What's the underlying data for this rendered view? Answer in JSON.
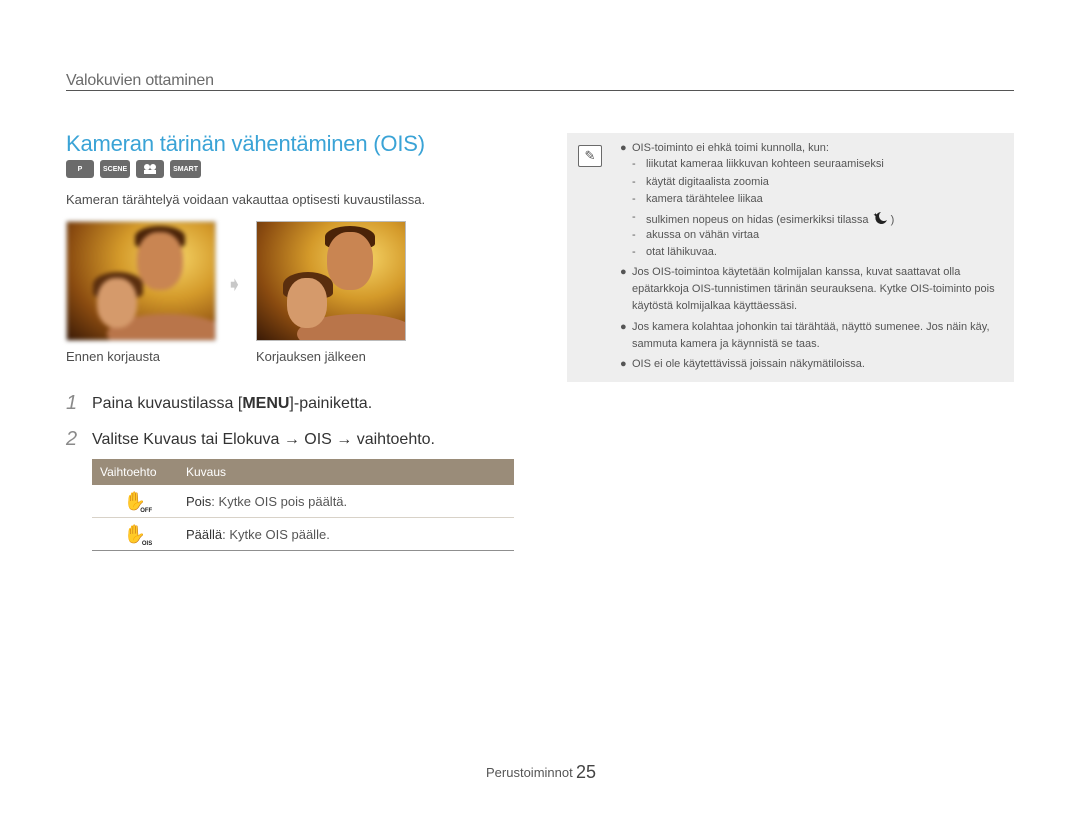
{
  "header": {
    "section": "Valokuvien ottaminen"
  },
  "title": "Kameran tärinän vähentäminen (OIS)",
  "mode_icons": [
    {
      "name": "program-mode-icon",
      "label": "P"
    },
    {
      "name": "scene-mode-icon",
      "label": "SCENE"
    },
    {
      "name": "movie-mode-icon",
      "label": ""
    },
    {
      "name": "smart-movie-mode-icon",
      "label": "SMART"
    }
  ],
  "intro": "Kameran tärähtelyä voidaan vakauttaa optisesti kuvaustilassa.",
  "images": {
    "before_caption": "Ennen korjausta",
    "after_caption": "Korjauksen jälkeen"
  },
  "steps": [
    {
      "num": "1",
      "pre": "Paina kuvaustilassa [",
      "key": "MENU",
      "post": "]-painiketta."
    },
    {
      "num": "2",
      "pre": "Valitse ",
      "a": "Kuvaus",
      "mid": " tai ",
      "b": "Elokuva",
      "arrow1": " → ",
      "c": "OIS",
      "arrow2": " → ",
      "post": "vaihtoehto."
    }
  ],
  "table": {
    "headers": [
      "Vaihtoehto",
      "Kuvaus"
    ],
    "rows": [
      {
        "icon": "ois-off-icon",
        "icon_badge": "OFF",
        "term": "Pois",
        "desc": ": Kytke OIS pois päältä."
      },
      {
        "icon": "ois-on-icon",
        "icon_badge": "OIS",
        "term": "Päällä",
        "desc": ": Kytke OIS päälle."
      }
    ]
  },
  "note": {
    "bullet1": "OIS-toiminto ei ehkä toimi kunnolla, kun:",
    "subitems": [
      "liikutat kameraa liikkuvan kohteen seuraamiseksi",
      "käytät digitaalista zoomia",
      "kamera tärähtelee liikaa",
      "sulkimen nopeus on hidas (esimerkiksi tilassa",
      "akussa on vähän virtaa",
      "otat lähikuvaa."
    ],
    "night_close": ")",
    "bullet2": "Jos OIS-toimintoa käytetään kolmijalan kanssa, kuvat saattavat olla epätarkkoja OIS-tunnistimen tärinän seurauksena. Kytke OIS-toiminto pois käytöstä kolmijalkaa käyttäessäsi.",
    "bullet3": "Jos kamera kolahtaa johonkin tai tärähtää, näyttö sumenee. Jos näin käy, sammuta kamera ja käynnistä se taas.",
    "bullet4": "OIS ei ole käytettävissä joissain näkymätiloissa."
  },
  "footer": {
    "label": "Perustoiminnot",
    "page": "25"
  }
}
